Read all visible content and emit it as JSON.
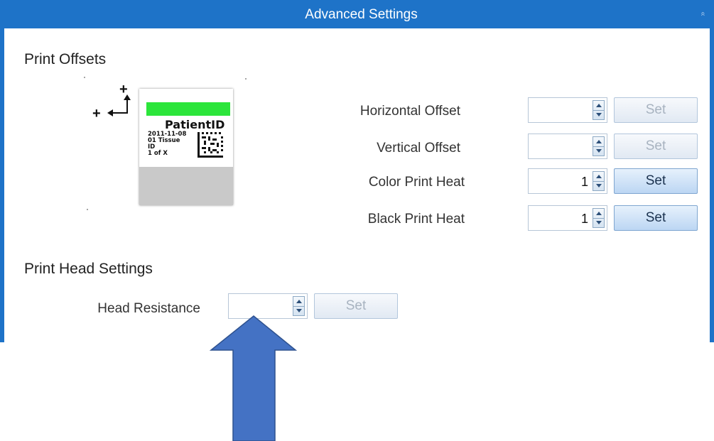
{
  "window": {
    "title": "Advanced Settings",
    "collapse_glyph": "»"
  },
  "print_offsets": {
    "title": "Print Offsets",
    "sample_label": {
      "patient_id": "PatientID",
      "lines": [
        "2011-11-08",
        "01 Tissue",
        "ID",
        "1 of X"
      ],
      "axis_plus": "+"
    },
    "rows": [
      {
        "label": "Horizontal Offset",
        "value": "",
        "button": "Set",
        "enabled": false
      },
      {
        "label": "Vertical Offset",
        "value": "",
        "button": "Set",
        "enabled": false
      },
      {
        "label": "Color Print Heat",
        "value": "1",
        "button": "Set",
        "enabled": true
      },
      {
        "label": "Black Print Heat",
        "value": "1",
        "button": "Set",
        "enabled": true
      }
    ]
  },
  "print_head": {
    "title": "Print Head Settings",
    "row": {
      "label": "Head Resistance",
      "value": "",
      "button": "Set",
      "enabled": false
    }
  },
  "colors": {
    "title_bar": "#1e73c8",
    "arrow_fill": "#4472c4",
    "arrow_stroke": "#2f528f",
    "label_green": "#2ce53b"
  }
}
